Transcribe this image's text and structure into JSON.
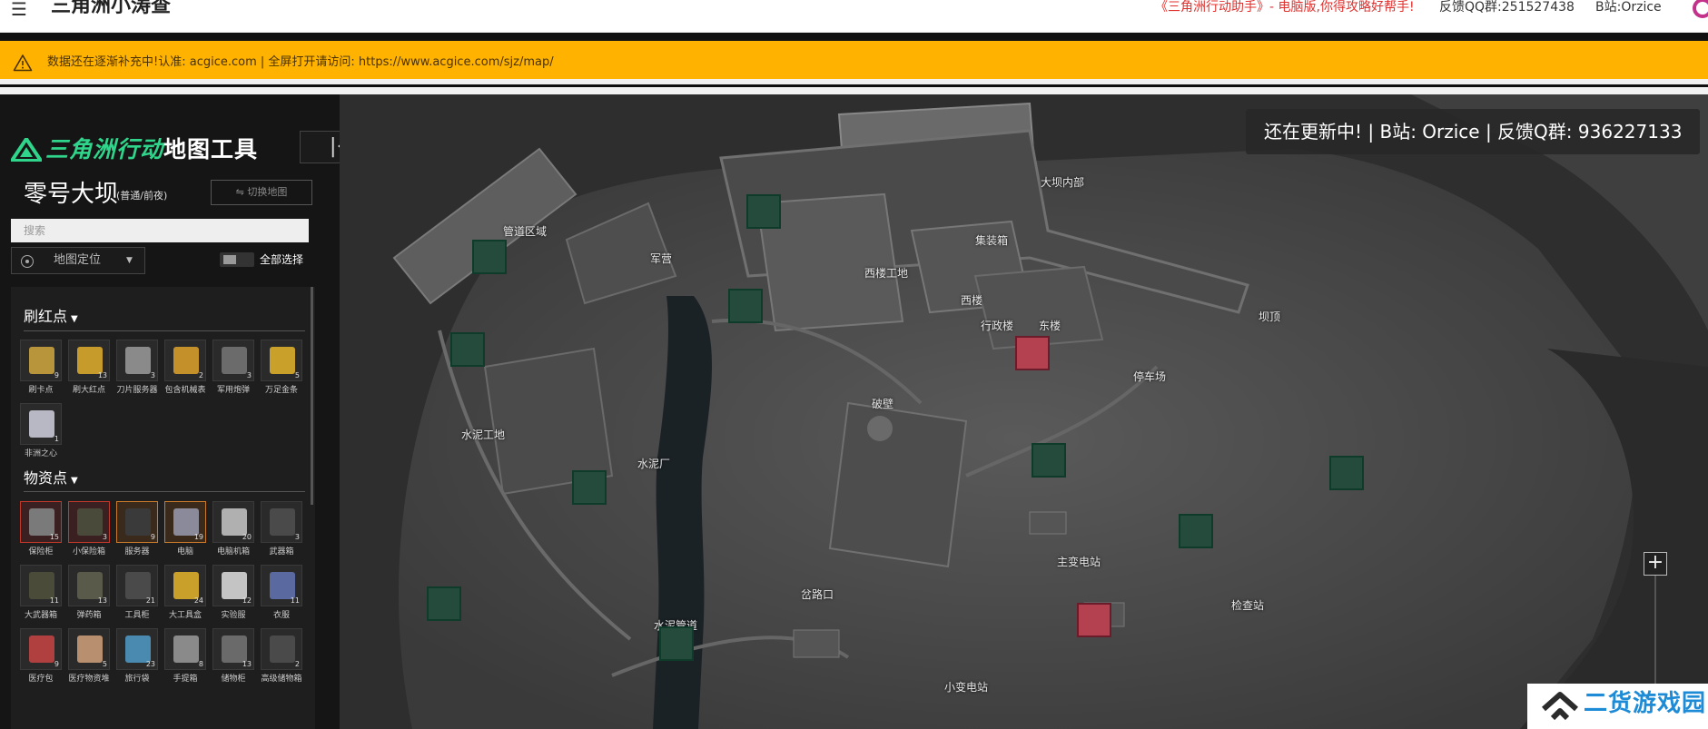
{
  "topnav": {
    "menu_icon": "menu-icon",
    "site_title": "三角洲小涛查",
    "promo": "《三角洲行动助手》- 电脑版,你得攻略好帮手!",
    "feedback_qq": "反馈QQ群:251527438",
    "bilibili": "B站:Orzice"
  },
  "alert": {
    "icon": "warning-icon",
    "text": "数据还在逐渐补充中!认准: acgice.com | 全屏打开请访问: https://www.acgice.com/sjz/map/"
  },
  "sidebar": {
    "brand": "三角洲行动",
    "brand_suffix": "地图工具",
    "collapse_icon": "collapse-left-icon",
    "map_name": "零号大坝",
    "map_mode": "(普通/前夜)",
    "switch_map": "切换地图",
    "search_placeholder": "搜索",
    "locate_label": "地图定位",
    "select_all": "全部选择",
    "sections": [
      {
        "title": "刷红点",
        "items": [
          {
            "label": "刷卡点",
            "count": "9",
            "color": "#b8953a"
          },
          {
            "label": "刷大红点",
            "count": "13",
            "color": "#c79a2c"
          },
          {
            "label": "刀片服务器",
            "count": "3",
            "color": "#8a8a8a"
          },
          {
            "label": "包含机械表",
            "count": "2",
            "color": "#c4902a"
          },
          {
            "label": "军用炮弹",
            "count": "3",
            "color": "#6b6b6b"
          },
          {
            "label": "万足金条",
            "count": "5",
            "color": "#c9a02a"
          },
          {
            "label": "非洲之心",
            "count": "1",
            "color": "#b8b8c4"
          }
        ]
      },
      {
        "title": "物资点",
        "items": [
          {
            "label": "保险柜",
            "count": "15",
            "color": "#7a7a7a",
            "border": "red"
          },
          {
            "label": "小保险箱",
            "count": "3",
            "color": "#4a4a3a",
            "border": "red"
          },
          {
            "label": "服务器",
            "count": "9",
            "color": "#3a3a3a",
            "border": "orange"
          },
          {
            "label": "电脑",
            "count": "19",
            "color": "#8a8a9a",
            "border": "orange"
          },
          {
            "label": "电脑机箱",
            "count": "20",
            "color": "#b0b0b0",
            "border": ""
          },
          {
            "label": "武器箱",
            "count": "3",
            "color": "#4a4a4a",
            "border": ""
          },
          {
            "label": "大武器箱",
            "count": "11",
            "color": "#4b4b3a",
            "border": ""
          },
          {
            "label": "弹药箱",
            "count": "13",
            "color": "#5a5a4a",
            "border": ""
          },
          {
            "label": "工具柜",
            "count": "21",
            "color": "#4a4a4a",
            "border": ""
          },
          {
            "label": "大工具盒",
            "count": "24",
            "color": "#c9a02a",
            "border": ""
          },
          {
            "label": "实验服",
            "count": "12",
            "color": "#c4c4c4",
            "border": ""
          },
          {
            "label": "衣服",
            "count": "11",
            "color": "#5a6aa0",
            "border": ""
          },
          {
            "label": "医疗包",
            "count": "9",
            "color": "#b04040",
            "border": ""
          },
          {
            "label": "医疗物资堆",
            "count": "5",
            "color": "#b89070",
            "border": ""
          },
          {
            "label": "旅行袋",
            "count": "23",
            "color": "#4a8ab0",
            "border": ""
          },
          {
            "label": "手提箱",
            "count": "8",
            "color": "#8a8a8a",
            "border": ""
          },
          {
            "label": "储物柜",
            "count": "13",
            "color": "#6a6a6a",
            "border": ""
          },
          {
            "label": "高级储物箱",
            "count": "2",
            "color": "#4a4a4a",
            "border": ""
          }
        ]
      }
    ]
  },
  "map": {
    "notice": "还在更新中! | B站: Orzice | 反馈Q群: 936227133",
    "zoom_in_icon": "plus-icon",
    "labels": [
      "大坝内部",
      "管道区域",
      "军营",
      "集装箱",
      "西楼工地",
      "西楼",
      "行政楼",
      "东楼",
      "坝顶",
      "停车场",
      "破壁",
      "水泥工地",
      "水泥厂",
      "主变电站",
      "检查站",
      "岔路口",
      "水泥管道",
      "小变电站"
    ],
    "markers": [
      {
        "type": "green"
      },
      {
        "type": "green"
      },
      {
        "type": "green"
      },
      {
        "type": "green"
      },
      {
        "type": "green"
      },
      {
        "type": "green"
      },
      {
        "type": "green"
      },
      {
        "type": "green"
      },
      {
        "type": "green"
      },
      {
        "type": "green"
      },
      {
        "type": "red"
      },
      {
        "type": "red"
      }
    ]
  },
  "watermark": {
    "icon": "house-logo-icon",
    "text": "二货游戏园"
  }
}
